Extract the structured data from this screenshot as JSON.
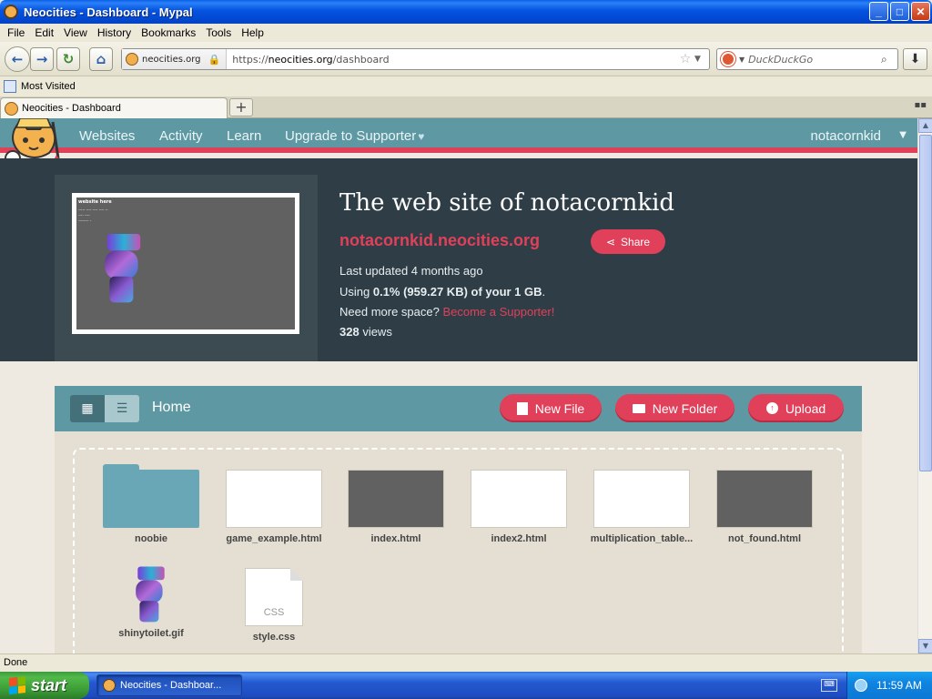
{
  "window": {
    "title": "Neocities - Dashboard - Mypal",
    "buttons": {
      "minimize": "_",
      "maximize": "□",
      "close": "✕"
    }
  },
  "menu": [
    "File",
    "Edit",
    "View",
    "History",
    "Bookmarks",
    "Tools",
    "Help"
  ],
  "navbar": {
    "identity": "neocities.org",
    "url_prefix": "https://",
    "url_host": "neocities.org",
    "url_path": "/dashboard",
    "search_placeholder": "DuckDuckGo"
  },
  "bookmarks": {
    "item": "Most Visited"
  },
  "tabs": {
    "active": "Neocities - Dashboard",
    "new_tab": "+"
  },
  "site_nav": {
    "links": [
      "Websites",
      "Activity",
      "Learn",
      "Upgrade to Supporter"
    ],
    "supporter_heart": "♥",
    "username": "notacornkid"
  },
  "hero": {
    "title": "The web site of notacornkid",
    "site_url": "notacornkid.neocities.org",
    "share_label": "Share",
    "last_updated": "Last updated 4 months ago",
    "usage_prefix": "Using ",
    "usage_value": "0.1% (959.27 KB) of your 1 GB",
    "usage_suffix": ".",
    "more_space_prefix": "Need more space? ",
    "supporter_link": "Become a Supporter!",
    "views_count": "328",
    "views_label": " views",
    "thumb_lines": [
      "website here",
      "----- ---- ---- ---- --",
      "---- ----",
      "-------- -"
    ]
  },
  "file_manager": {
    "location": "Home",
    "new_file": "New File",
    "new_folder": "New Folder",
    "upload": "Upload",
    "files": [
      {
        "name": "noobie",
        "kind": "folder"
      },
      {
        "name": "game_example.html",
        "kind": "html-light"
      },
      {
        "name": "index.html",
        "kind": "html-dark"
      },
      {
        "name": "index2.html",
        "kind": "html-light"
      },
      {
        "name": "multiplication_table...",
        "kind": "html-light"
      },
      {
        "name": "not_found.html",
        "kind": "html-dark"
      },
      {
        "name": "shinytoilet.gif",
        "kind": "image"
      },
      {
        "name": "style.css",
        "kind": "css",
        "badge": "CSS"
      }
    ]
  },
  "status": {
    "text": "Done"
  },
  "taskbar": {
    "start": "start",
    "task": "Neocities - Dashboar...",
    "clock": "11:59 AM"
  }
}
